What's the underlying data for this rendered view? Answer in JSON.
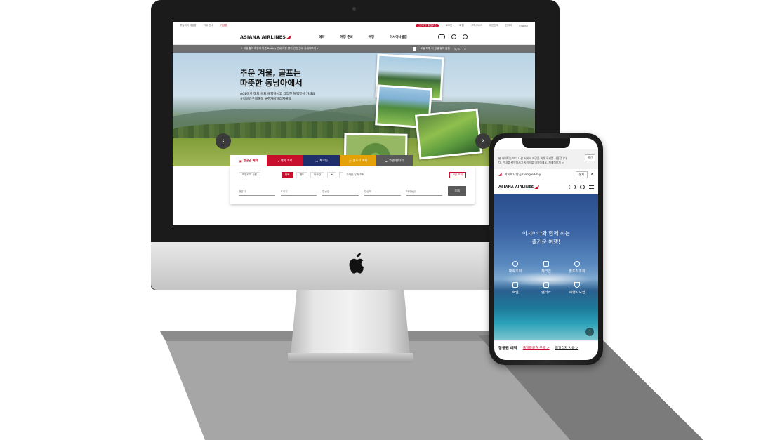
{
  "desktop": {
    "util": {
      "items": [
        "루돌피미 계정왕",
        "기내 안내",
        "기념품"
      ],
      "badge": "신규회원 웰컴쿠폰",
      "links": [
        "로그인",
        "회원",
        "고객서비스",
        "대한민국",
        "한국어",
        "English"
      ]
    },
    "brand": "ASIANA AIRLINES",
    "menu": [
      "예약",
      "여행 준비",
      "여행",
      "아시아나클럽"
    ],
    "notice": {
      "text": "!  최일 월드 확장에 따른 Bubbly 변쇄 이용 뿐기 관한 안내  자세히보기 >",
      "check_label": "오늘 하루 이 창을 열지 않음",
      "pager": "1 / 1"
    },
    "hero": {
      "title": "추운 겨울, 골프는\n따뜻한 동남아에서",
      "subtitle": "AGL에서 해외 골프 예약하시고 다양한 혜택받아 가세요\n#항공권구매혜택 #추가마일리지혜택"
    },
    "booking": {
      "tabs": [
        "항공권 예약",
        "예약 조회",
        "체크인",
        "출도착 조회",
        "호텔/렌터카"
      ],
      "options": [
        "마일리지 사용",
        "왕복",
        "편도",
        "다구간"
      ],
      "checkbox_label": "가까운 날짜 조회",
      "coupon_label": "쿠폰 조회",
      "fields": [
        "출발지",
        "도착지",
        "탑승일",
        "탑승객",
        "좌석등급"
      ],
      "search_label": "조회"
    }
  },
  "mobile": {
    "cookie_text": "본 사이트는 보다 나은 서비스 제공을 위해 쿠키를 사용합니다.\n다. 안내를 확인하시고 사이트를 이용하세요. 자세히보기 >",
    "cookie_ok": "확인",
    "app_banner": {
      "text": "아시아나항공 Google Play",
      "install": "설치"
    },
    "brand": "ASIANA AIRLINES",
    "hero_title": "아시아나와 함께 하는\n즐거운 여행!",
    "quick": [
      "예약조회",
      "체크인",
      "출도착조회",
      "호텔",
      "렌터카",
      "여행자보험"
    ],
    "footer": {
      "title": "항공권 예약",
      "link1": "출발항공권 구매 >",
      "link2": "마일리지 사용 >"
    }
  },
  "colors": {
    "accent": "#c8102e",
    "navy": "#1f2f6b",
    "gold": "#e3a20a"
  }
}
